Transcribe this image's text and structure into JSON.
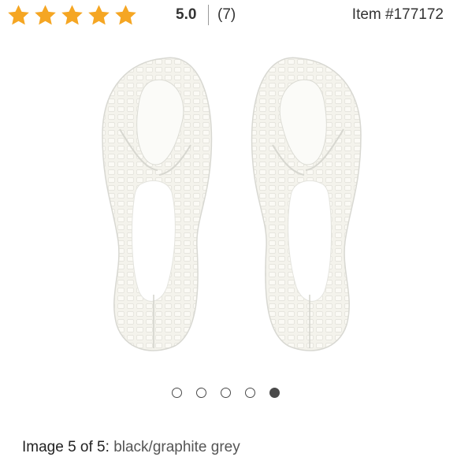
{
  "rating": {
    "stars_filled": 5,
    "stars_total": 5,
    "score": "5.0",
    "count": "(7)",
    "star_color": "#f5a623"
  },
  "item_number": "Item #177172",
  "product_image": {
    "icon": "shoe-soles-image"
  },
  "carousel": {
    "total": 5,
    "active_index": 4
  },
  "caption": {
    "prefix": "Image 5 of 5:",
    "color": "black/graphite grey"
  }
}
